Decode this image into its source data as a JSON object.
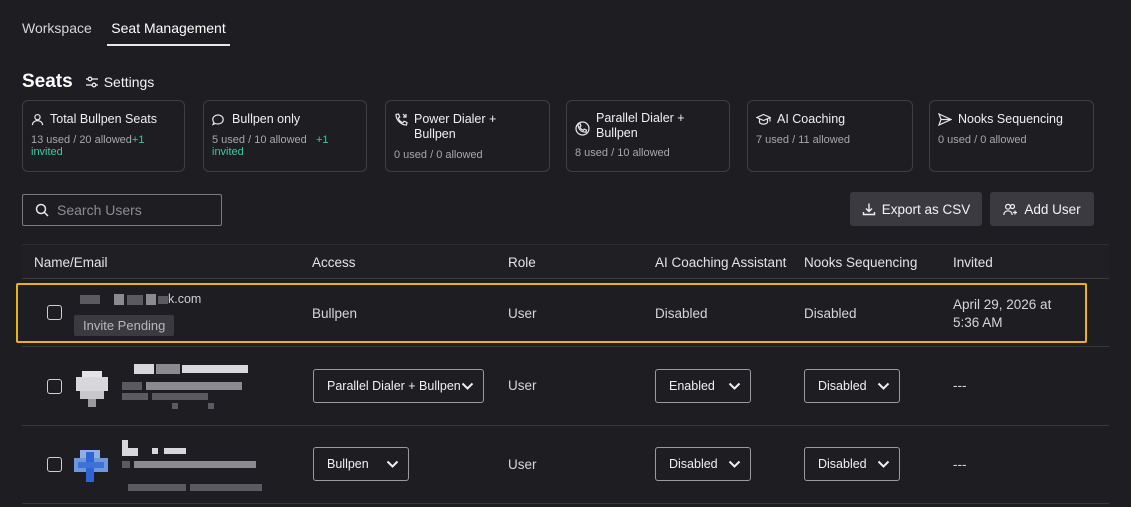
{
  "tabs": [
    {
      "label": "Workspace",
      "active": false
    },
    {
      "label": "Seat Management",
      "active": true
    }
  ],
  "seats": {
    "title": "Seats",
    "settings_label": "Settings"
  },
  "cards": [
    {
      "icon": "user-icon",
      "title": "Total Bullpen Seats",
      "stat": "13 used / 20 allowed",
      "invited": "+1 invited"
    },
    {
      "icon": "chat-bubbles-icon",
      "title": "Bullpen only",
      "stat": "5 used / 10 allowed",
      "invited": "+1 invited"
    },
    {
      "icon": "phone-dialer-icon",
      "title": "Power Dialer + Bullpen",
      "stat": "0 used / 0 allowed",
      "invited": ""
    },
    {
      "icon": "phone-bubble-icon",
      "title": "Parallel Dialer + Bullpen",
      "stat": "8 used / 10 allowed",
      "invited": ""
    },
    {
      "icon": "graduation-cap-icon",
      "title": "AI Coaching",
      "stat": "7 used / 11 allowed",
      "invited": ""
    },
    {
      "icon": "send-icon",
      "title": "Nooks Sequencing",
      "stat": "0 used / 0 allowed",
      "invited": ""
    }
  ],
  "search": {
    "placeholder": "Search Users",
    "value": ""
  },
  "actions": {
    "export_label": "Export as CSV",
    "add_user_label": "Add User"
  },
  "table": {
    "headers": [
      "Name/Email",
      "Access",
      "Role",
      "AI Coaching Assistant",
      "Nooks Sequencing",
      "Invited"
    ],
    "rows": [
      {
        "email_suffix": "k.com",
        "badge": "Invite Pending",
        "access": "Bullpen",
        "role": "User",
        "ai_coaching": "Disabled",
        "sequencing": "Disabled",
        "invited_line1": "April 29, 2026 at",
        "invited_line2": "5:36 AM"
      },
      {
        "access": "Parallel Dialer + Bullpen",
        "role": "User",
        "ai_coaching": "Enabled",
        "sequencing": "Disabled",
        "invited": "---"
      },
      {
        "access": "Bullpen",
        "role": "User",
        "ai_coaching": "Disabled",
        "sequencing": "Disabled",
        "invited": "---"
      }
    ]
  },
  "colors": {
    "background": "#1e1e22",
    "invited_accent": "#3ec7a0",
    "highlight": "#e6b418"
  }
}
